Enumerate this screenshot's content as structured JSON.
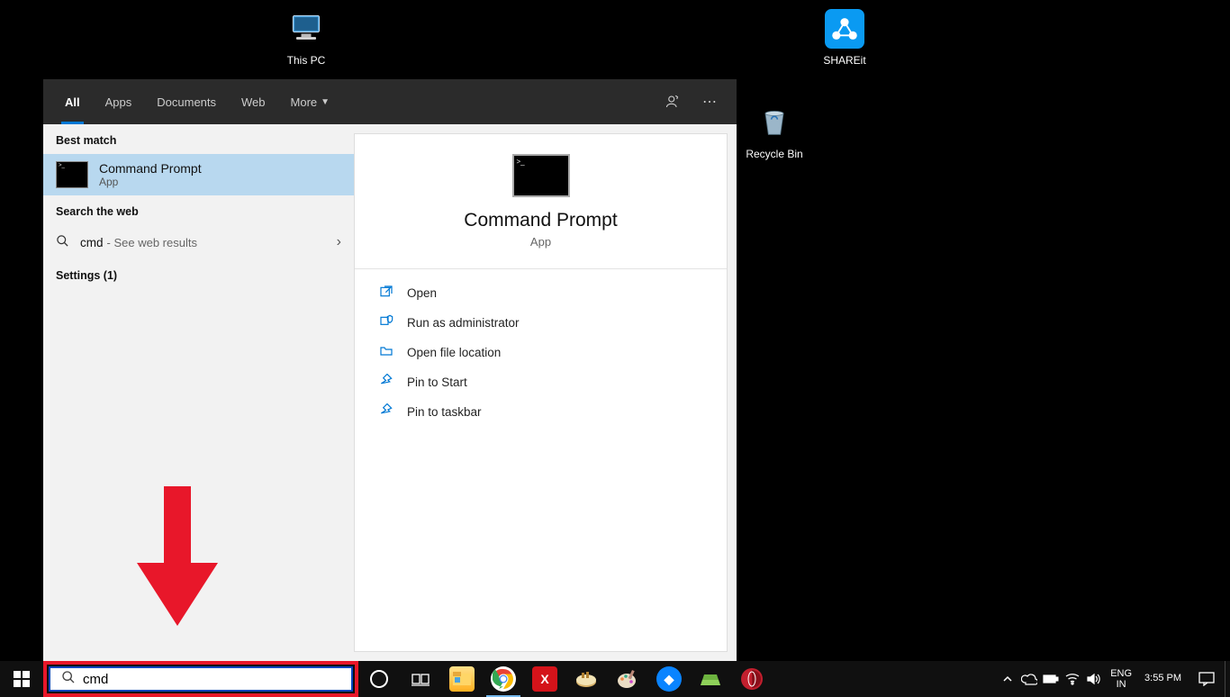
{
  "desktop": {
    "this_pc": "This PC",
    "shareit": "SHAREit",
    "recycle": "Recycle Bin"
  },
  "search": {
    "tabs": [
      "All",
      "Apps",
      "Documents",
      "Web",
      "More"
    ],
    "best_match_label": "Best match",
    "result_name": "Command Prompt",
    "result_type": "App",
    "web_label": "Search the web",
    "web_query": "cmd",
    "web_hint": "- See web results",
    "settings_label": "Settings (1)",
    "detail_title": "Command Prompt",
    "detail_sub": "App",
    "actions": {
      "open": "Open",
      "admin": "Run as administrator",
      "loc": "Open file location",
      "pinstart": "Pin to Start",
      "pintask": "Pin to taskbar"
    }
  },
  "taskbar": {
    "search_value": "cmd"
  },
  "tray": {
    "lang1": "ENG",
    "lang2": "IN",
    "time": "3:55 PM",
    "date": ""
  }
}
